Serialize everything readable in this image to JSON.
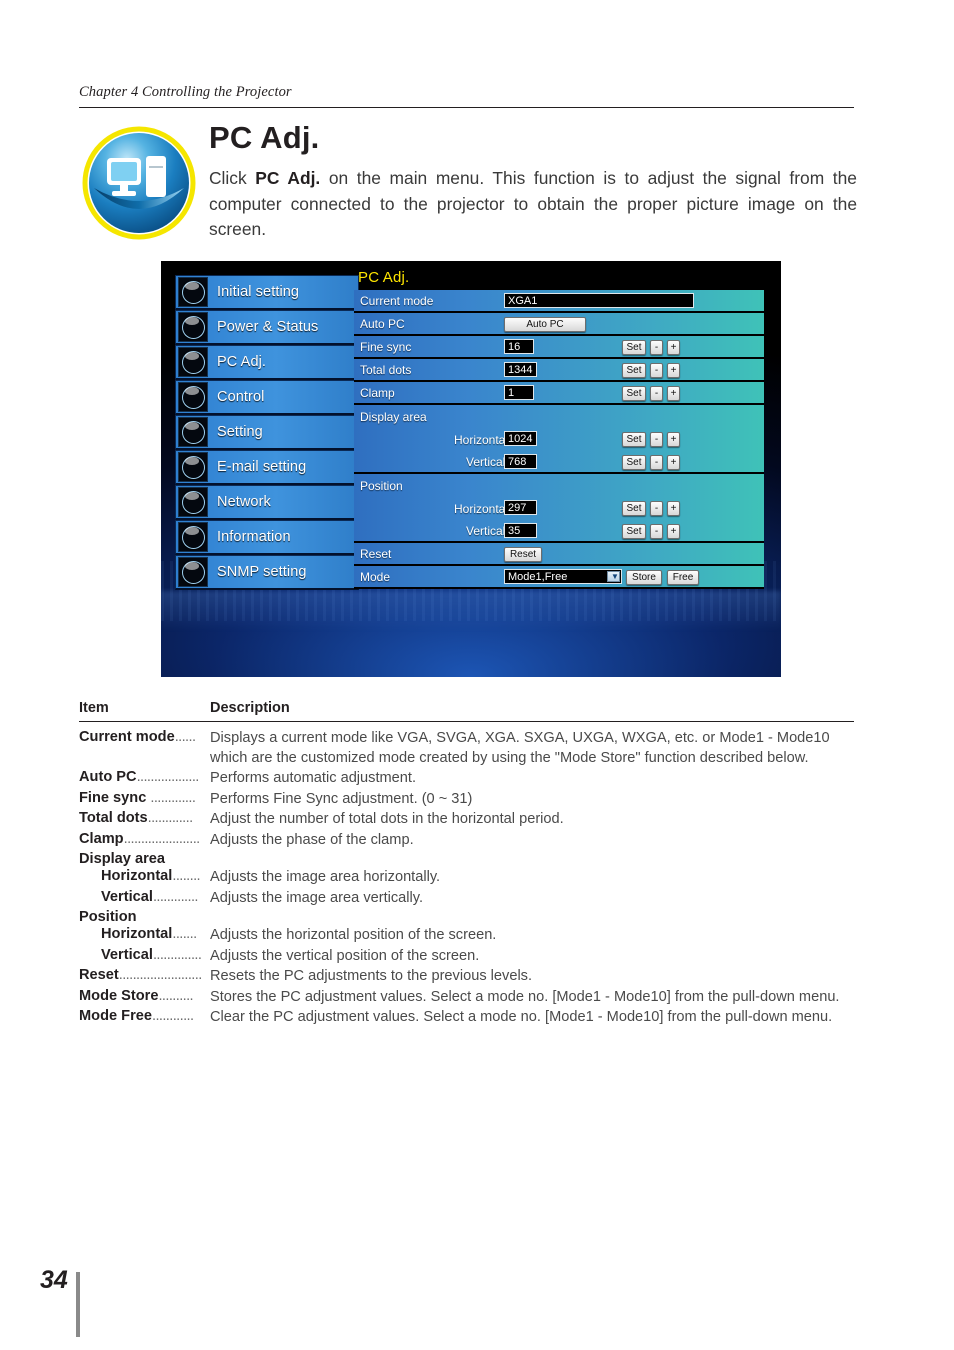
{
  "running_head": "Chapter 4 Controlling the Projector",
  "title": "PC Adj.",
  "intro_before": "Click ",
  "intro_bold": "PC Adj.",
  "intro_after": " on the main menu. This function is to adjust the signal from the computer connected to the projector to obtain the proper picture image on the screen.",
  "page_number": "34",
  "screenshot": {
    "sidebar": {
      "items": [
        {
          "label": "Initial setting",
          "icon": "initial-setting-icon"
        },
        {
          "label": "Power & Status",
          "icon": "power-status-icon"
        },
        {
          "label": "PC Adj.",
          "icon": "pc-adj-icon"
        },
        {
          "label": "Control",
          "icon": "control-icon"
        },
        {
          "label": "Setting",
          "icon": "setting-icon"
        },
        {
          "label": "E-mail setting",
          "icon": "email-setting-icon"
        },
        {
          "label": "Network",
          "icon": "network-icon"
        },
        {
          "label": "Information",
          "icon": "information-icon"
        },
        {
          "label": "SNMP setting",
          "icon": "snmp-setting-icon"
        }
      ]
    },
    "panel": {
      "title": "PC Adj.",
      "current_mode_label": "Current mode",
      "current_mode_value": "XGA1",
      "auto_pc_label": "Auto PC",
      "auto_pc_button": "Auto PC",
      "fine_sync_label": "Fine sync",
      "fine_sync_value": "16",
      "total_dots_label": "Total dots",
      "total_dots_value": "1344",
      "clamp_label": "Clamp",
      "clamp_value": "1",
      "display_area_label": "Display area",
      "display_area_h_label": "Horizontal",
      "display_area_h_value": "1024",
      "display_area_v_label": "Vertical",
      "display_area_v_value": "768",
      "position_label": "Position",
      "position_h_label": "Horizontal",
      "position_h_value": "297",
      "position_v_label": "Vertical",
      "position_v_value": "35",
      "reset_label": "Reset",
      "reset_button": "Reset",
      "mode_label": "Mode",
      "mode_value": "Mode1,Free",
      "store_button": "Store",
      "free_button": "Free",
      "set_button": "Set",
      "minus_button": "-",
      "plus_button": "+"
    }
  },
  "table": {
    "header_item": "Item",
    "header_description": "Description",
    "rows": [
      {
        "item": "Current mode",
        "dots": "......",
        "desc": "Displays a current mode like VGA, SVGA, XGA. SXGA, UXGA, WXGA, etc. or Mode1 - Mode10 which are the customized mode created by using the \"Mode Store\" function described below."
      },
      {
        "item": "Auto PC",
        "dots": "..................",
        "desc": "Performs automatic adjustment."
      },
      {
        "item": "Fine sync ",
        "dots": ".............",
        "desc": "Performs Fine Sync adjustment. (0 ~ 31)"
      },
      {
        "item": "Total dots",
        "dots": ".............",
        "desc": "Adjust the number of total dots in the horizontal period."
      },
      {
        "item": "Clamp",
        "dots": "......................",
        "desc": "Adjusts the phase of the clamp."
      },
      {
        "item": "Display area",
        "dots": "",
        "desc": ""
      },
      {
        "item": "Horizontal",
        "dots": "........",
        "desc": "Adjusts the image area horizontally.",
        "indent": true
      },
      {
        "item": "Vertical",
        "dots": ".............",
        "desc": "Adjusts the image area vertically.",
        "indent": true
      },
      {
        "item": "Position",
        "dots": "",
        "desc": ""
      },
      {
        "item": "Horizontal",
        "dots": ".......",
        "desc": "Adjusts the horizontal position of the screen.",
        "indent": true
      },
      {
        "item": "Vertical",
        "dots": "..............",
        "desc": "Adjusts the vertical position of the screen.",
        "indent": true
      },
      {
        "item": "Reset",
        "dots": "........................",
        "desc": "Resets the PC adjustments to the previous levels."
      },
      {
        "item": "Mode Store",
        "dots": "..........",
        "desc": "Stores the PC adjustment values. Select a mode no. [Mode1 - Mode10] from the pull-down menu."
      },
      {
        "item": "Mode Free",
        "dots": "............",
        "desc": "Clear the PC adjustment values. Select a mode no.  [Mode1 - Mode10] from the pull-down menu."
      }
    ]
  }
}
